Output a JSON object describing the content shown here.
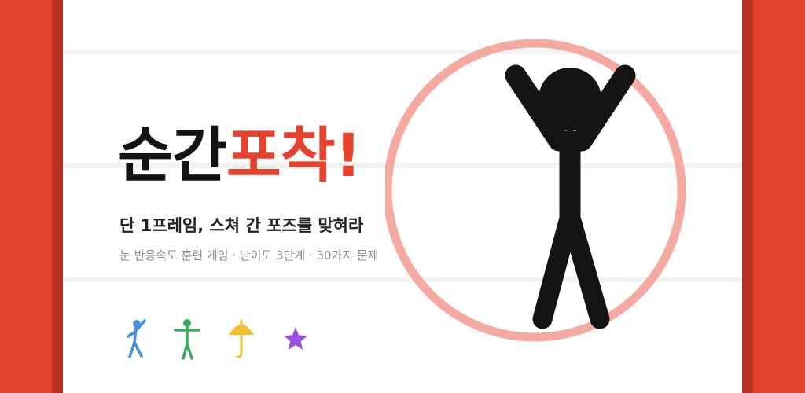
{
  "banner": {
    "title_main": "순간",
    "title_accent": "포착!",
    "subtitle": "단 1프레임, 스쳐 간 포즈를 맞혀라",
    "caption": "눈 반응속도 훈련 게임 · 난이도 3단계 · 30가지 문제"
  },
  "colors": {
    "curtain": "#e6422e",
    "curtain_shadow": "#b83223",
    "accent": "#e6422e",
    "ring": "#f4aaa1",
    "figure": "#141414",
    "mini_blue": "#4a8fe0",
    "mini_green": "#3aaa5c",
    "mini_yellow": "#f2c02c",
    "mini_purple": "#9b4fe0"
  },
  "icons": {
    "hero": "stick-figure-arms-up-icon",
    "poses": [
      "stick-figure-running-icon",
      "stick-figure-t-pose-icon",
      "umbrella-icon",
      "star-icon"
    ]
  }
}
